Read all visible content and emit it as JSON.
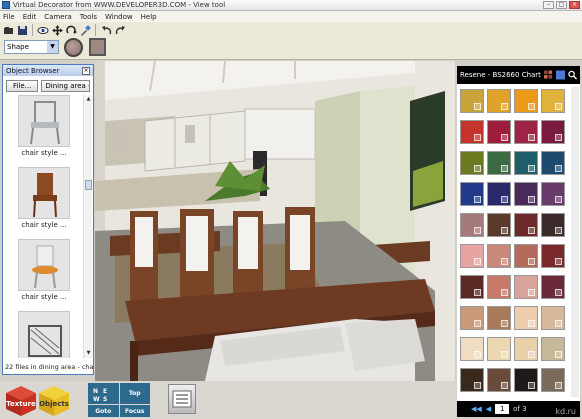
{
  "window": {
    "title": "Virtual Decorator from WWW.DEVELOPER3D.COM - View tool"
  },
  "menu": [
    "File",
    "Edit",
    "Camera",
    "Tools",
    "Window",
    "Help"
  ],
  "toolbar": {
    "shape_select": "Shape"
  },
  "object_browser": {
    "title": "Object Browser",
    "file_button": "File...",
    "group_button": "Dining area - c",
    "items": [
      {
        "label": "chair style ...",
        "color": "#b5b8bc"
      },
      {
        "label": "chair style ...",
        "color": "#8b4a22"
      },
      {
        "label": "chair style ...",
        "color": "#e08a30"
      },
      {
        "label": "",
        "color": "#9a9a9a"
      }
    ],
    "status": "22 files in dining area - cha"
  },
  "color_chart": {
    "title": "Resene - BS2660 Chart",
    "page_current": "1",
    "page_of": "of 3",
    "swatches": [
      "#c9a43a",
      "#e0a22a",
      "#ec9a1a",
      "#e0b23a",
      "#c4342a",
      "#9c1e3a",
      "#9e2446",
      "#7a1a40",
      "#6a7a20",
      "#3c6a42",
      "#1e5e6a",
      "#1e4a6e",
      "#223a8a",
      "#2a2a6a",
      "#4a2a5a",
      "#6a3a6a",
      "#a47a7a",
      "#5a3a2a",
      "#6e2a2a",
      "#3a2a2a",
      "#e8a4a0",
      "#c8887a",
      "#b46a5a",
      "#7a2a2a",
      "#5a2a24",
      "#c87a6a",
      "#d8a49a",
      "#6a2a3a",
      "#c89a78",
      "#a87a5a",
      "#ecccaa",
      "#d8b89a",
      "#f0dcc0",
      "#ecd8b0",
      "#e8d0a8",
      "#c8b89a",
      "#3a2a1e",
      "#6a4a3a",
      "#1e1a1a",
      "#7a6a5a"
    ]
  },
  "bottom": {
    "texture_label": "Texture",
    "objects_label": "Objects",
    "nav_top": "Top",
    "nav_goto": "Goto",
    "nav_focus": "Focus"
  },
  "watermark": "kd.ru"
}
